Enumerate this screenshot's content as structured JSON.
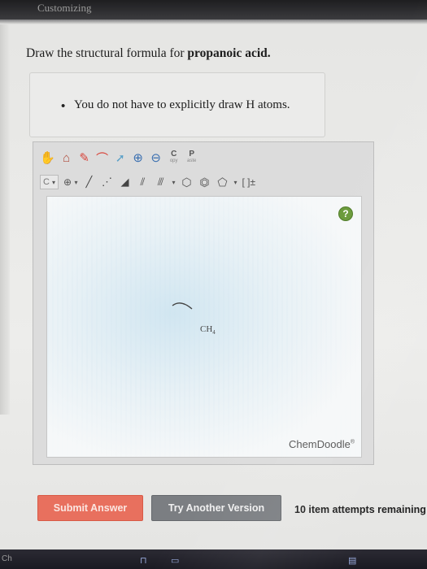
{
  "header": {
    "title": "Customizing",
    "scrollbar_color": "#9aa7b5"
  },
  "question": {
    "prefix": "Draw the structural formula for ",
    "compound": "propanoic acid",
    "suffix": "."
  },
  "hint": {
    "bullet": "•",
    "text": "You do not have to explicitly draw H atoms."
  },
  "toolbar": {
    "copy_main": "C",
    "copy_sub": "opy",
    "paste_main": "P",
    "paste_sub": "aste",
    "element_value": "C",
    "charge_symbol": "⊕",
    "caret": "▾",
    "bracket": "[ ]±",
    "icons": [
      "hand-icon",
      "eraser-icon",
      "pencil-icon",
      "lasso-icon",
      "select-icon",
      "zoom-in-icon",
      "zoom-out-icon"
    ]
  },
  "canvas": {
    "help_label": "?",
    "atom_main": "CH",
    "atom_sub": "4",
    "watermark": "ChemDoodle",
    "watermark_mark": "®"
  },
  "buttons": {
    "submit": "Submit Answer",
    "try_another": "Try Another Version"
  },
  "attempts": "10 item attempts remaining",
  "taskbar": {
    "corner_label": "Ch"
  },
  "colors": {
    "submit_bg": "#e8705e",
    "try_bg": "#7b7e82",
    "help_bg": "#6a9a3a"
  }
}
